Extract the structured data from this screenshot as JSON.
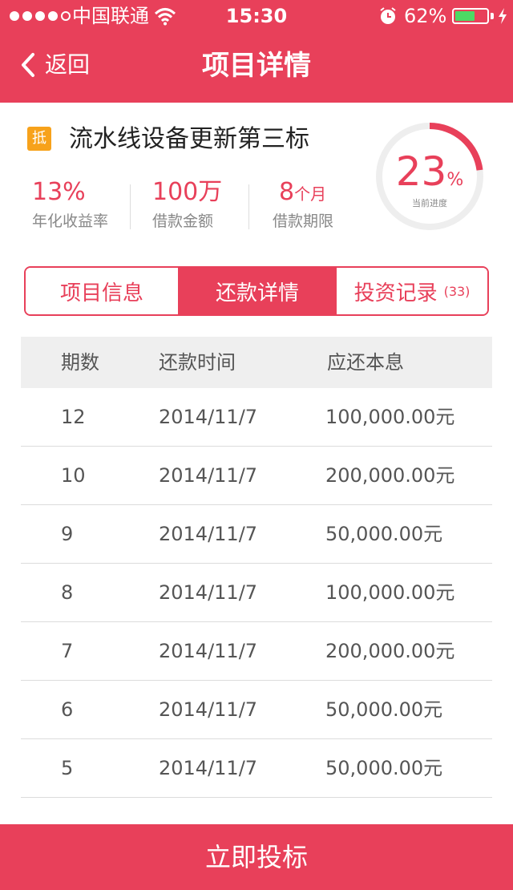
{
  "status_bar": {
    "carrier": "中国联通",
    "time": "15:30",
    "battery_percent": "62%",
    "battery_level": 0.62,
    "signal_bars_filled": 4,
    "signal_bars_total": 5
  },
  "nav": {
    "back_label": "返回",
    "title": "项目详情"
  },
  "project": {
    "badge": "抵",
    "name": "流水线设备更新第三标",
    "stats": [
      {
        "value": "13%",
        "unit": "",
        "label": "年化收益率"
      },
      {
        "value": "100万",
        "unit": "",
        "label": "借款金额"
      },
      {
        "value": "8",
        "unit": "个月",
        "label": "借款期限"
      }
    ],
    "progress": {
      "value": "23",
      "percent_sign": "%",
      "label": "当前进度",
      "fraction": 0.23
    }
  },
  "tabs": [
    {
      "label": "项目信息",
      "count": "",
      "active": false
    },
    {
      "label": "还款详情",
      "count": "",
      "active": true
    },
    {
      "label": "投资记录",
      "count": "(33)",
      "active": false
    }
  ],
  "repayment_table": {
    "headers": [
      "期数",
      "还款时间",
      "应还本息"
    ],
    "rows": [
      [
        "12",
        "2014/11/7",
        "100,000.00元"
      ],
      [
        "10",
        "2014/11/7",
        "200,000.00元"
      ],
      [
        "9",
        "2014/11/7",
        "50,000.00元"
      ],
      [
        "8",
        "2014/11/7",
        "100,000.00元"
      ],
      [
        "7",
        "2014/11/7",
        "200,000.00元"
      ],
      [
        "6",
        "2014/11/7",
        "50,000.00元"
      ],
      [
        "5",
        "2014/11/7",
        "50,000.00元"
      ]
    ]
  },
  "footer": {
    "invest_label": "立即投标"
  },
  "colors": {
    "accent": "#e8405a",
    "badge": "#f7a21b",
    "battery_fill": "#4cd964"
  }
}
